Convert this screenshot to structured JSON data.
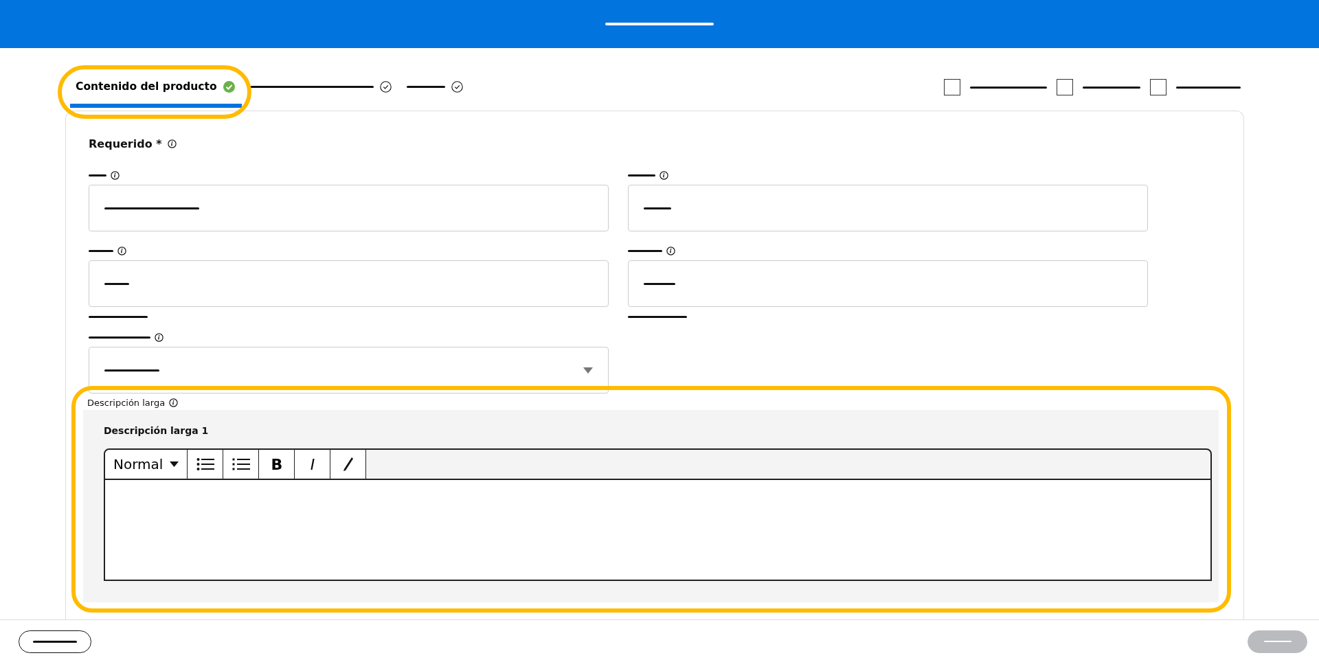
{
  "tabs": [
    {
      "label": "Contenido del producto",
      "selected": true
    },
    {
      "selected": false
    },
    {
      "selected": false
    }
  ],
  "steps": [
    {
      "checked": false
    },
    {
      "checked": false
    },
    {
      "checked": false
    }
  ],
  "section": {
    "title": "Requerido *"
  },
  "left_fields": [
    {
      "kind": "text"
    },
    {
      "kind": "text",
      "helper": true
    },
    {
      "kind": "select"
    }
  ],
  "right_fields": [
    {
      "kind": "text"
    },
    {
      "kind": "text",
      "helper": true
    }
  ],
  "description": {
    "label": "Descripción larga",
    "title": "Descripción larga 1",
    "toolbar": [
      {
        "kind": "format",
        "text": "Normal"
      },
      {
        "kind": "bullets"
      },
      {
        "kind": "numbers"
      },
      {
        "kind": "bold",
        "text": "B"
      },
      {
        "kind": "italic",
        "text": "I"
      },
      {
        "kind": "pen"
      }
    ]
  }
}
